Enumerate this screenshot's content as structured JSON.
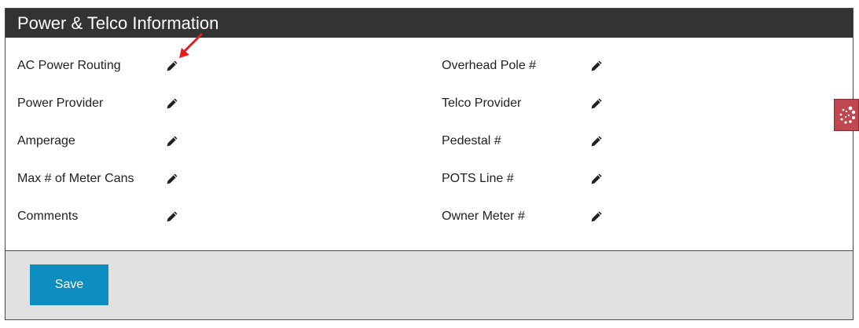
{
  "panel": {
    "title": "Power & Telco Information"
  },
  "fields": {
    "left": [
      {
        "label": "AC Power Routing"
      },
      {
        "label": "Power Provider"
      },
      {
        "label": "Amperage"
      },
      {
        "label": "Max # of Meter Cans"
      },
      {
        "label": "Comments"
      }
    ],
    "right": [
      {
        "label": "Overhead Pole #"
      },
      {
        "label": "Telco Provider"
      },
      {
        "label": "Pedestal #"
      },
      {
        "label": "POTS Line #"
      },
      {
        "label": "Owner Meter #"
      }
    ]
  },
  "footer": {
    "save_label": "Save"
  },
  "colors": {
    "header_bg": "#333333",
    "save_button": "#0e8ec0",
    "annotation_arrow": "#e02020",
    "side_widget": "#c0464f"
  },
  "icons": {
    "edit": "pencil-icon",
    "side_widget": "dotted-spinner-icon"
  }
}
